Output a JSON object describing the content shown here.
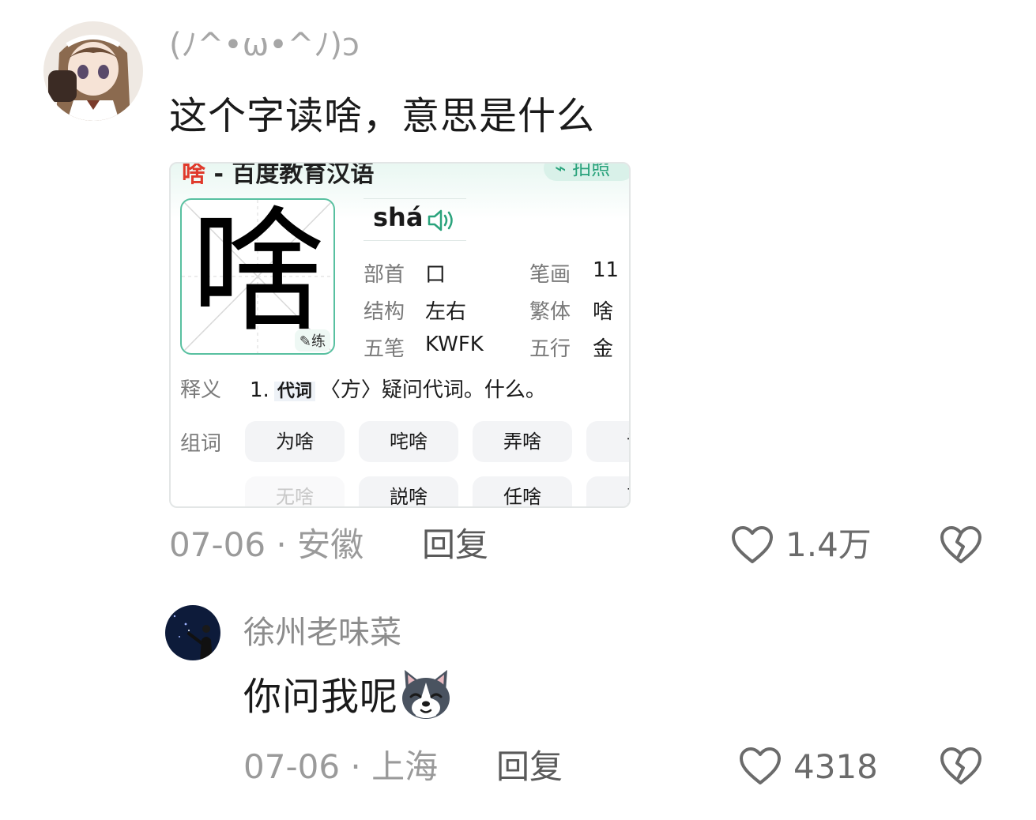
{
  "comments": [
    {
      "username": "(ﾉ^•ω•^ﾉ)ɔ",
      "text": "这个字读啥，意思是什么",
      "date": "07-06",
      "separator": "·",
      "location": "安徽",
      "reply_label": "回复",
      "likes": "1.4万",
      "icons": {
        "like": "heart-outline-icon",
        "dislike": "broken-heart-icon"
      }
    },
    {
      "username": "徐州老味菜",
      "text": "你问我呢",
      "emoji": "husky-dog-emoji",
      "date": "07-06",
      "separator": "·",
      "location": "上海",
      "reply_label": "回复",
      "likes": "4318",
      "icons": {
        "like": "heart-outline-icon",
        "dislike": "broken-heart-icon"
      }
    }
  ],
  "dictionary_card": {
    "title_char": "啥",
    "title_rest": " - 百度教育汉语",
    "photo_label": "拍照",
    "character": "啥",
    "practice_label": "练",
    "pinyin": "shá",
    "speaker_icon": "speaker-icon",
    "fields": {
      "radical_label": "部首",
      "radical": "口",
      "strokes_label": "笔画",
      "strokes": "11",
      "structure_label": "结构",
      "structure": "左右",
      "traditional_label": "繁体",
      "traditional": "啥",
      "wubi_label": "五笔",
      "wubi": "KWFK",
      "wuxing_label": "五行",
      "wuxing": "金"
    },
    "definition": {
      "label": "释义",
      "number": "1.",
      "pos": "代词",
      "text": "〈方〉疑问代词。什么。"
    },
    "words_label": "组词",
    "words_row1": [
      "为啥",
      "咤啥",
      "弄啥",
      "说"
    ],
    "words_row2": [
      "无啥",
      "説啥",
      "任啥",
      "更"
    ]
  }
}
